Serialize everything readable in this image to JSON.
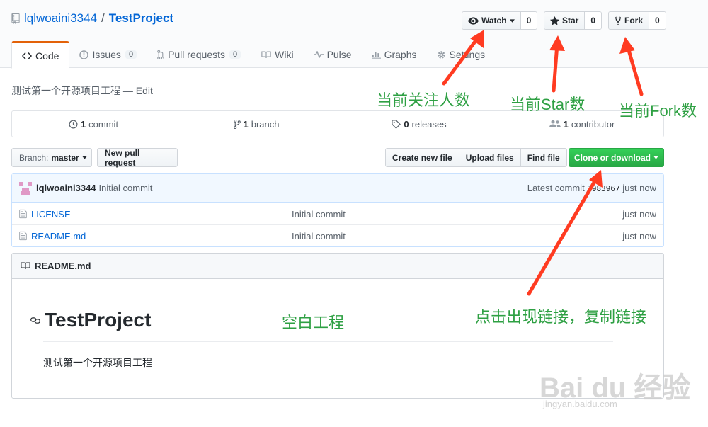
{
  "repo": {
    "owner": "lqlwoaini3344",
    "separator": "/",
    "name": "TestProject"
  },
  "actions": {
    "watch": {
      "label": "Watch",
      "count": "0"
    },
    "star": {
      "label": "Star",
      "count": "0"
    },
    "fork": {
      "label": "Fork",
      "count": "0"
    }
  },
  "tabs": [
    {
      "label": "Code"
    },
    {
      "label": "Issues",
      "count": "0"
    },
    {
      "label": "Pull requests",
      "count": "0"
    },
    {
      "label": "Wiki"
    },
    {
      "label": "Pulse"
    },
    {
      "label": "Graphs"
    },
    {
      "label": "Settings"
    }
  ],
  "description": "测试第一个开源项目工程 — Edit",
  "summary": {
    "commits": {
      "num": "1",
      "label": "commit"
    },
    "branches": {
      "num": "1",
      "label": "branch"
    },
    "releases": {
      "num": "0",
      "label": "releases"
    },
    "contributors": {
      "num": "1",
      "label": "contributor"
    }
  },
  "toolbar": {
    "branch_prefix": "Branch:",
    "branch_name": "master",
    "new_pull_request": "New pull request",
    "create_new_file": "Create new file",
    "upload_files": "Upload files",
    "find_file": "Find file",
    "clone_or_download": "Clone or download"
  },
  "latest_commit": {
    "author": "lqlwoaini3344",
    "message": "Initial commit",
    "latest_prefix": "Latest commit",
    "sha": "1983967",
    "age": "just now"
  },
  "files": [
    {
      "name": "LICENSE",
      "message": "Initial commit",
      "age": "just now"
    },
    {
      "name": "README.md",
      "message": "Initial commit",
      "age": "just now"
    }
  ],
  "readme": {
    "header": "README.md",
    "title": "TestProject",
    "body": "测试第一个开源项目工程"
  },
  "annotations": {
    "watch": "当前关注人数",
    "star": "当前Star数",
    "fork": "当前Fork数",
    "empty": "空白工程",
    "clone": "点击出现链接，复制链接"
  },
  "watermark": {
    "logo": "Bai du 经验",
    "url": "jingyan.baidu.com"
  },
  "colors": {
    "annotation": "#2ea043",
    "arrow": "#ff3b21",
    "clone_button": "#28a745",
    "link": "#0366d6",
    "active_tab": "#e36209"
  }
}
